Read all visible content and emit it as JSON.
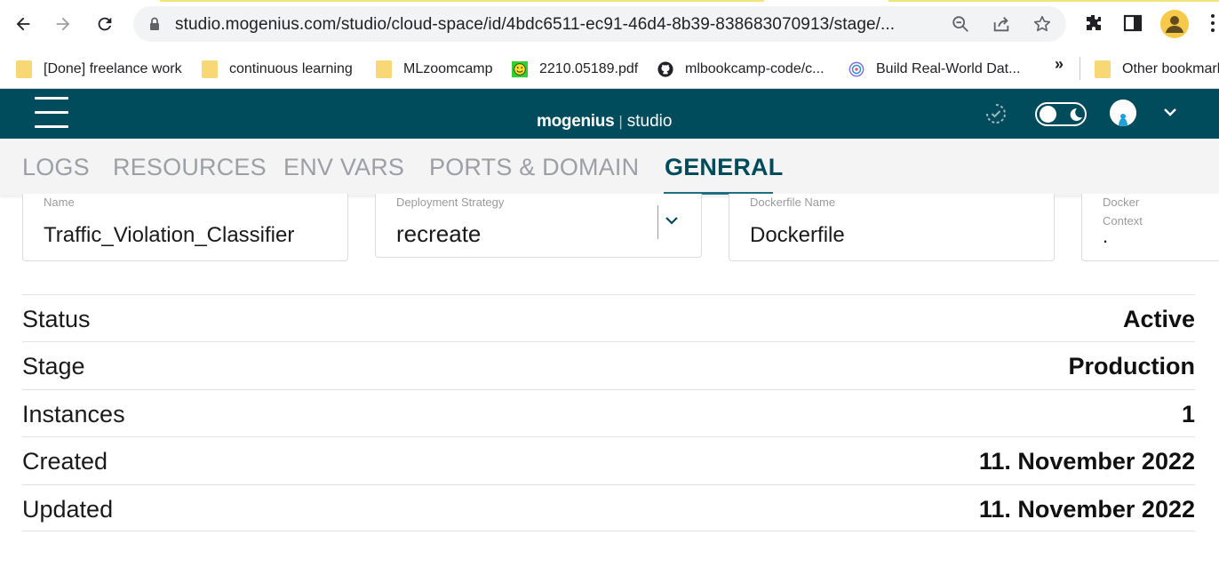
{
  "browser": {
    "url": "studio.mogenius.com/studio/cloud-space/id/4bdc6511-ec91-46d4-8b39-838683070913/stage/...",
    "bookmarks": [
      {
        "label": "[Done] freelance work",
        "icon": "folder-icon"
      },
      {
        "label": "continuous learning",
        "icon": "folder-icon"
      },
      {
        "label": "MLzoomcamp",
        "icon": "folder-icon"
      },
      {
        "label": "2210.05189.pdf",
        "icon": "smiley-icon"
      },
      {
        "label": "mlbookcamp-code/c...",
        "icon": "github-icon"
      },
      {
        "label": "Build Real-World Dat...",
        "icon": "target-icon"
      }
    ],
    "more_bookmarks": "»",
    "other_bookmarks": "Other bookmarks"
  },
  "app": {
    "brand_name": "mogenius",
    "brand_sep": "|",
    "brand_product": "studio"
  },
  "tabs": [
    {
      "label": "LOGS",
      "active": false
    },
    {
      "label": "RESOURCES",
      "active": false
    },
    {
      "label": "ENV VARS",
      "active": false
    },
    {
      "label": "PORTS & DOMAIN",
      "active": false
    },
    {
      "label": "GENERAL",
      "active": true
    }
  ],
  "fields": {
    "name": {
      "label": "Name",
      "value": "Traffic_Violation_Classifier"
    },
    "deployment_strategy": {
      "label": "Deployment Strategy",
      "value": "recreate"
    },
    "dockerfile_name": {
      "label": "Dockerfile Name",
      "value": "Dockerfile"
    },
    "docker_context": {
      "label_line1": "Docker",
      "label_line2": "Context",
      "value": "."
    }
  },
  "info": [
    {
      "key": "Status",
      "value": "Active"
    },
    {
      "key": "Stage",
      "value": "Production"
    },
    {
      "key": "Instances",
      "value": "1"
    },
    {
      "key": "Created",
      "value": "11. November 2022"
    },
    {
      "key": "Updated",
      "value": "11. November 2022"
    }
  ],
  "colors": {
    "header_bg": "#004b5c",
    "tab_active": "#004b5c",
    "tab_inactive": "#9aa0a6"
  }
}
